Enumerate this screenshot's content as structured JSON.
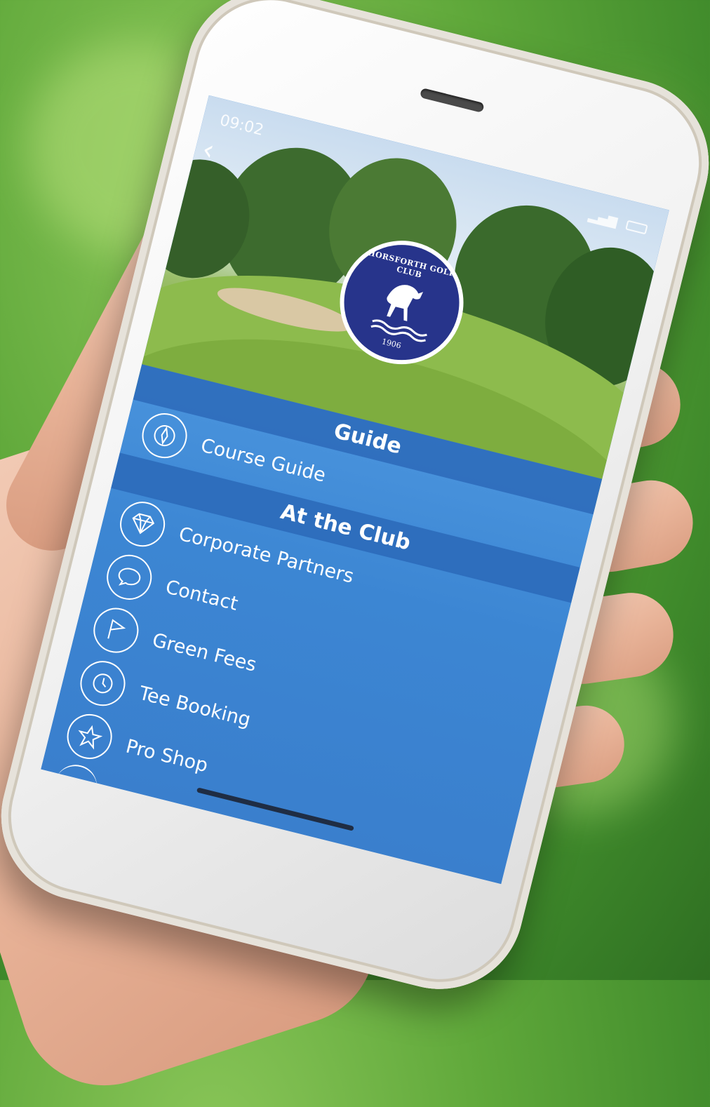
{
  "status_bar": {
    "time": "09:02"
  },
  "club": {
    "name": "HORSFORTH GOLF CLUB",
    "year": "1906"
  },
  "sections": [
    {
      "title": "Guide",
      "items": [
        {
          "label": "Course Guide",
          "icon": "compass-icon"
        }
      ]
    },
    {
      "title": "At the Club",
      "items": [
        {
          "label": "Corporate Partners",
          "icon": "diamond-icon"
        },
        {
          "label": "Contact",
          "icon": "chat-bubble-icon"
        },
        {
          "label": "Green Fees",
          "icon": "flag-icon"
        },
        {
          "label": "Tee Booking",
          "icon": "clock-icon"
        },
        {
          "label": "Pro Shop",
          "icon": "star-icon"
        }
      ]
    }
  ],
  "colors": {
    "menu_blue": "#3c86d3",
    "header_blue": "#2864b4",
    "logo_navy": "#27348b"
  }
}
